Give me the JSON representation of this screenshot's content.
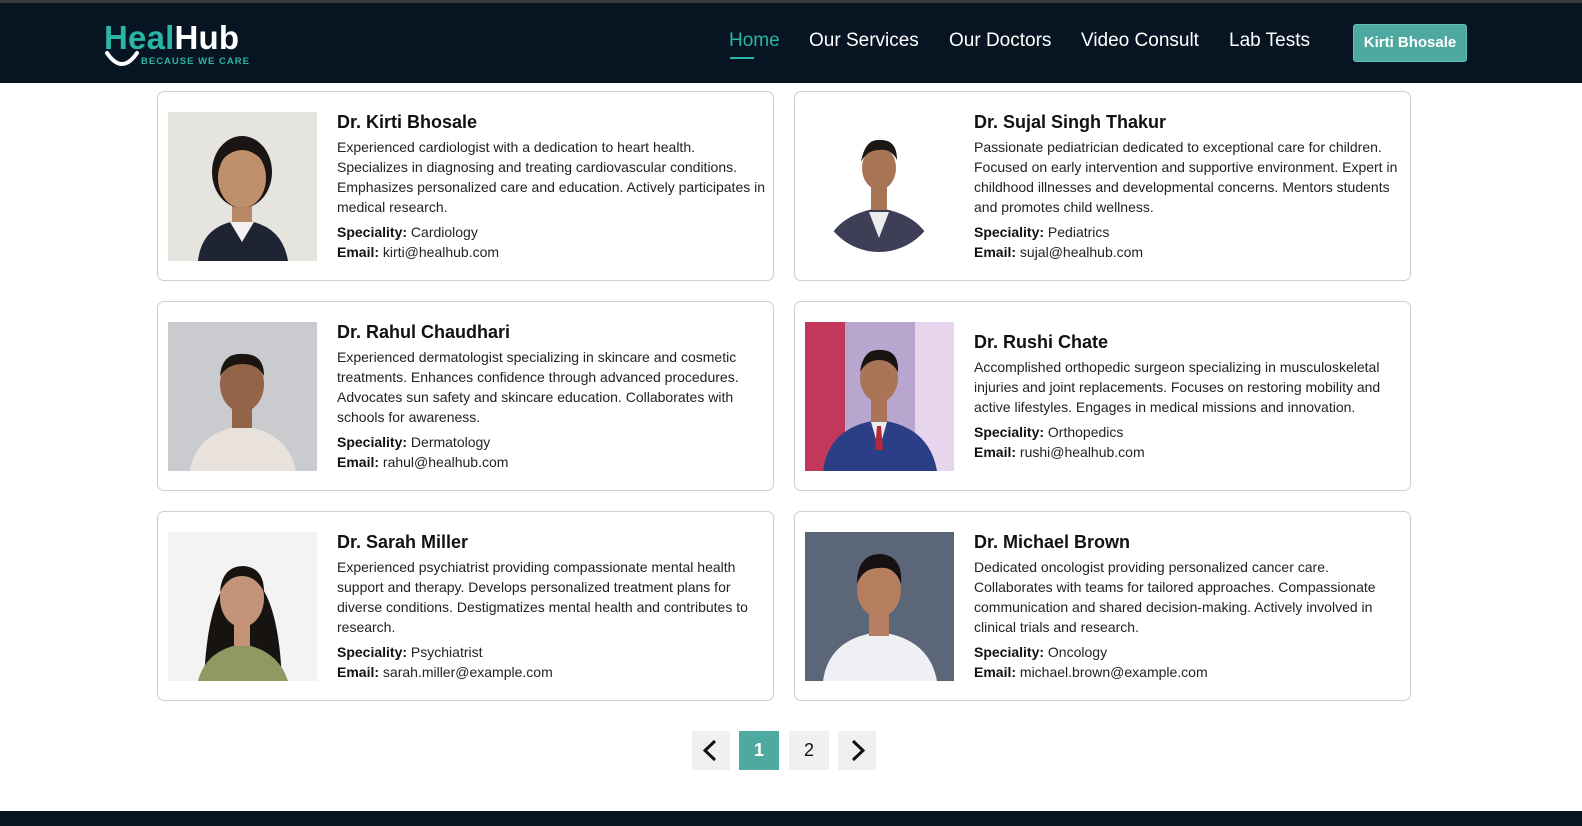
{
  "brand": {
    "name_a": "Heal",
    "name_b": "Hub",
    "tagline": "BECAUSE WE CARE",
    "accent": "#2bb5a6",
    "navbar_bg": "#071522"
  },
  "nav": {
    "items": [
      {
        "label": "Home",
        "active": true
      },
      {
        "label": "Our Services"
      },
      {
        "label": "Our Doctors"
      },
      {
        "label": "Video Consult"
      },
      {
        "label": "Lab Tests"
      }
    ],
    "user_button": "Kirti Bhosale"
  },
  "doctors": [
    {
      "name": "Dr. Kirti Bhosale",
      "bio": "Experienced cardiologist with a dedication to heart health. Specializes in diagnosing and treating cardiovascular conditions. Emphasizes personalized care and education. Actively participates in medical research.",
      "speciality_label": "Speciality:",
      "speciality": "Cardiology",
      "email_label": "Email:",
      "email": "kirti@healhub.com"
    },
    {
      "name": "Dr. Sujal Singh Thakur",
      "bio": "Passionate pediatrician dedicated to exceptional care for children. Focused on early intervention and supportive environment. Expert in childhood illnesses and developmental concerns. Mentors students and promotes child wellness.",
      "speciality_label": "Speciality:",
      "speciality": "Pediatrics",
      "email_label": "Email:",
      "email": "sujal@healhub.com"
    },
    {
      "name": "Dr. Rahul Chaudhari",
      "bio": "Experienced dermatologist specializing in skincare and cosmetic treatments. Enhances confidence through advanced procedures. Advocates sun safety and skincare education. Collaborates with schools for awareness.",
      "speciality_label": "Speciality:",
      "speciality": "Dermatology",
      "email_label": "Email:",
      "email": "rahul@healhub.com"
    },
    {
      "name": "Dr. Rushi Chate",
      "bio": "Accomplished orthopedic surgeon specializing in musculoskeletal injuries and joint replacements. Focuses on restoring mobility and active lifestyles. Engages in medical missions and innovation.",
      "speciality_label": "Speciality:",
      "speciality": "Orthopedics",
      "email_label": "Email:",
      "email": "rushi@healhub.com"
    },
    {
      "name": "Dr. Sarah Miller",
      "bio": "Experienced psychiatrist providing compassionate mental health support and therapy. Develops personalized treatment plans for diverse conditions. Destigmatizes mental health and contributes to research.",
      "speciality_label": "Speciality:",
      "speciality": "Psychiatrist",
      "email_label": "Email:",
      "email": "sarah.miller@example.com"
    },
    {
      "name": "Dr. Michael Brown",
      "bio": "Dedicated oncologist providing personalized cancer care. Collaborates with teams for tailored approaches. Compassionate communication and shared decision-making. Actively involved in clinical trials and research.",
      "speciality_label": "Speciality:",
      "speciality": "Oncology",
      "email_label": "Email:",
      "email": "michael.brown@example.com"
    }
  ],
  "pagination": {
    "prev_icon": "chevron-left",
    "pages": [
      "1",
      "2"
    ],
    "current": "1",
    "next_icon": "chevron-right"
  }
}
